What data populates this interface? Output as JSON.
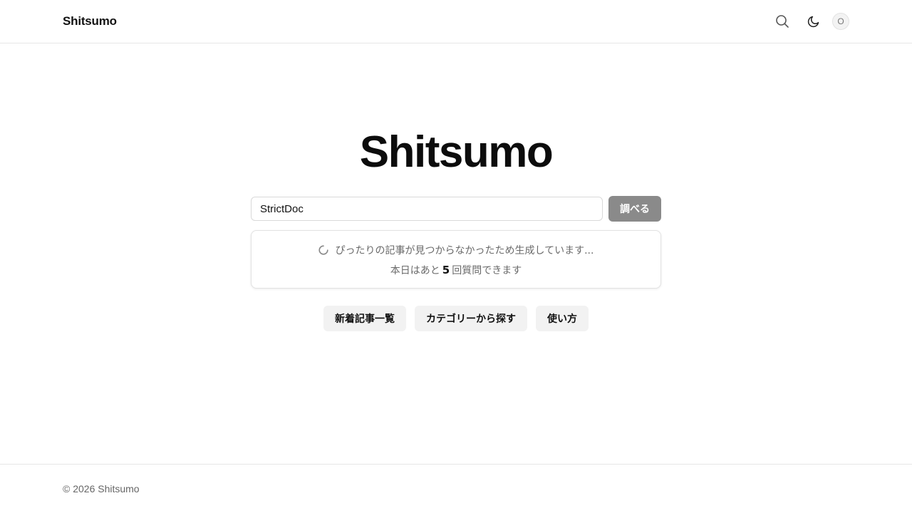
{
  "header": {
    "brand": "Shitsumo",
    "icons": {
      "search": "search-icon",
      "theme": "moon-icon"
    },
    "avatar_initial": "O"
  },
  "hero": {
    "title": "Shitsumo"
  },
  "search": {
    "value": "StrictDoc",
    "placeholder": "",
    "submit_label": "調べる"
  },
  "status": {
    "generating_text": "ぴったりの記事が見つからなかったため生成しています...",
    "quota_prefix": "本日はあと",
    "quota_count": "5",
    "quota_suffix": "回質問できます"
  },
  "quick_links": [
    {
      "label": "新着記事一覧"
    },
    {
      "label": "カテゴリーから探す"
    },
    {
      "label": "使い方"
    }
  ],
  "footer": {
    "copyright": "© 2026 Shitsumo"
  },
  "colors": {
    "text": "#111111",
    "muted": "#6a6a6a",
    "button_disabled": "#8a8a8a",
    "quick_bg": "#f2f2f2",
    "border": "#e6e6e6"
  }
}
